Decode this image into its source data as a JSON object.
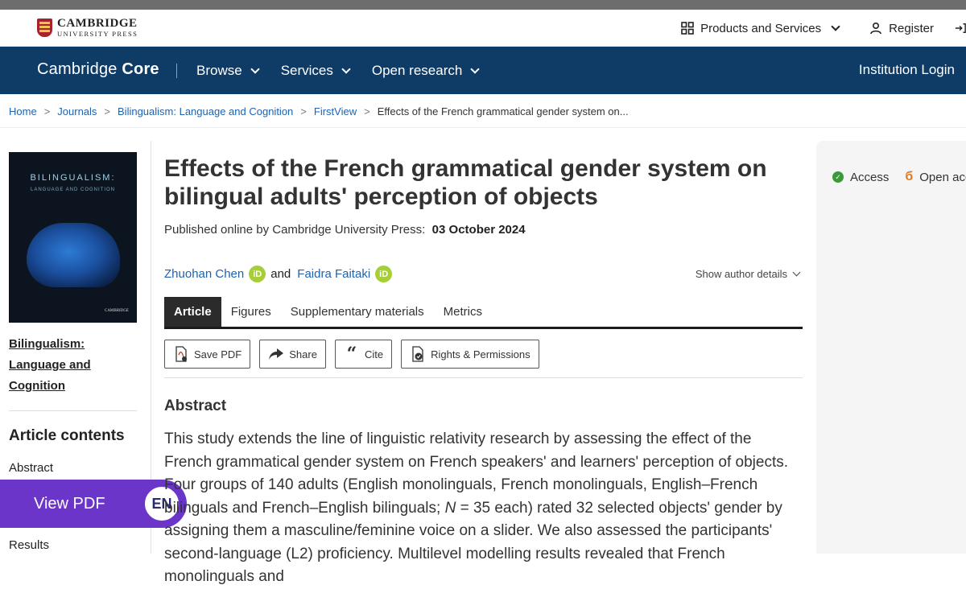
{
  "topbar": {
    "logo": {
      "line1": "CAMBRIDGE",
      "line2": "UNIVERSITY PRESS"
    },
    "products_label": "Products and Services",
    "register_label": "Register"
  },
  "navbar": {
    "brand_light": "Cambridge",
    "brand_bold": "Core",
    "items": [
      {
        "label": "Browse"
      },
      {
        "label": "Services"
      },
      {
        "label": "Open research"
      }
    ],
    "institution_login": "Institution Login"
  },
  "breadcrumb": {
    "items": [
      "Home",
      "Journals",
      "Bilingualism: Language and Cognition",
      "FirstView"
    ],
    "current": "Effects of the French grammatical gender system on..."
  },
  "sidebar": {
    "cover": {
      "title": "BILINGUALISM:",
      "subtitle": "LANGUAGE AND COGNITION",
      "publisher": "CAMBRIDGE"
    },
    "journal_link": "Bilingualism: Language and Cognition",
    "contents_title": "Article contents",
    "contents_items": [
      "Abstract",
      "Results"
    ],
    "view_pdf_label": "View PDF",
    "language_badge": "EN"
  },
  "article": {
    "title": "Effects of the French grammatical gender system on bilingual adults' perception of objects",
    "published_prefix": "Published online by Cambridge University Press:",
    "published_date": "03 October 2024",
    "authors": [
      {
        "name": "Zhuohan Chen",
        "orcid_label": "iD"
      },
      {
        "name": "Faidra Faitaki",
        "orcid_label": "iD"
      }
    ],
    "author_connector": "and",
    "show_author_details": "Show author details",
    "tabs": [
      {
        "label": "Article",
        "active": true
      },
      {
        "label": "Figures"
      },
      {
        "label": "Supplementary materials"
      },
      {
        "label": "Metrics"
      }
    ],
    "tools": [
      {
        "label": "Save PDF",
        "icon": "pdf-icon"
      },
      {
        "label": "Share",
        "icon": "share-icon"
      },
      {
        "label": "Cite",
        "icon": "quote-icon"
      },
      {
        "label": "Rights & Permissions",
        "icon": "permissions-icon"
      }
    ],
    "abstract_heading": "Abstract",
    "abstract_text_1": "This study extends the line of linguistic relativity research by assessing the effect of the French grammatical gender system on French speakers' and learners' perception of objects. Four groups of 140 adults (English monolinguals, French monolinguals, English–French bilinguals and French–English bilinguals; ",
    "abstract_N": "N",
    "abstract_text_2": " = 35 each) rated 32 selected objects' gender by assigning them a masculine/feminine voice on a slider. We also assessed the participants' second-language (L2) proficiency. Multilevel modelling results revealed that French monolinguals and"
  },
  "rightpanel": {
    "access_label": "Access",
    "open_access_label": "Open access"
  },
  "colors": {
    "navbar": "#0e3c66",
    "link": "#1d63ae",
    "view_pdf": "#6b35c9",
    "orcid": "#a6ce39"
  }
}
